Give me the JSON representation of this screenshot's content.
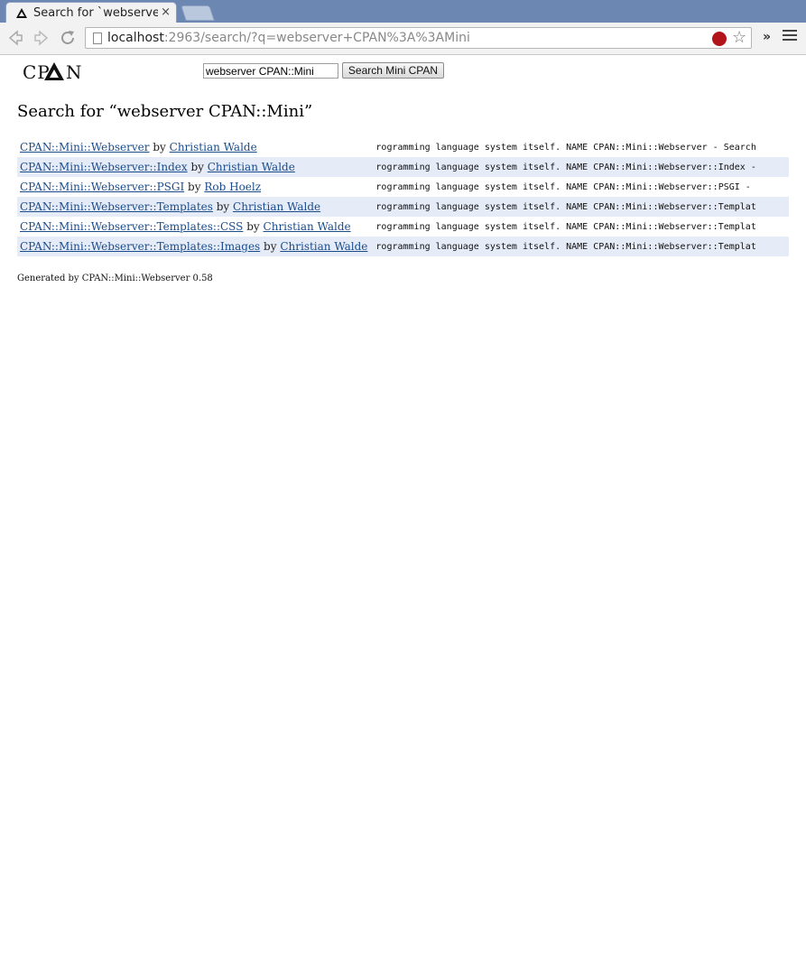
{
  "browser": {
    "tab_title": "Search for `webserver",
    "tab_close": "×",
    "url_host": "localhost",
    "url_rest": ":2963/search/?q=webserver+CPAN%3A%3AMini",
    "extensions_label": "»"
  },
  "header": {
    "logo_text": "CPAN",
    "search_value": "webserver CPAN::Mini",
    "search_button": "Search Mini CPAN"
  },
  "main": {
    "title": "Search for “webserver CPAN::Mini”",
    "results": [
      {
        "module": "CPAN::Mini::Webserver",
        "by": "by",
        "author": "Christian Walde",
        "snippet": "rogramming language system itself. NAME CPAN::Mini::Webserver - Search"
      },
      {
        "module": "CPAN::Mini::Webserver::Index",
        "by": "by",
        "author": "Christian Walde",
        "snippet": "rogramming language system itself. NAME CPAN::Mini::Webserver::Index -"
      },
      {
        "module": "CPAN::Mini::Webserver::PSGI",
        "by": "by",
        "author": "Rob Hoelz",
        "snippet": "rogramming language system itself. NAME CPAN::Mini::Webserver::PSGI -"
      },
      {
        "module": "CPAN::Mini::Webserver::Templates",
        "by": "by",
        "author": "Christian Walde",
        "snippet": "rogramming language system itself. NAME CPAN::Mini::Webserver::Templat"
      },
      {
        "module": "CPAN::Mini::Webserver::Templates::CSS",
        "by": "by",
        "author": "Christian Walde",
        "snippet": "rogramming language system itself. NAME CPAN::Mini::Webserver::Templat"
      },
      {
        "module": "CPAN::Mini::Webserver::Templates::Images",
        "by": "by",
        "author": "Christian Walde",
        "snippet": "rogramming language system itself. NAME CPAN::Mini::Webserver::Templat"
      }
    ],
    "footer": "Generated by CPAN::Mini::Webserver 0.58"
  },
  "colors": {
    "tabbar": "#6b87b2",
    "link": "#1a4c8c",
    "row_alt": "#e5ebf7"
  },
  "icons": [
    "cpan-favicon-icon",
    "back-icon",
    "forward-icon",
    "reload-icon",
    "page-icon",
    "stop-icon",
    "star-icon",
    "menu-icon"
  ]
}
